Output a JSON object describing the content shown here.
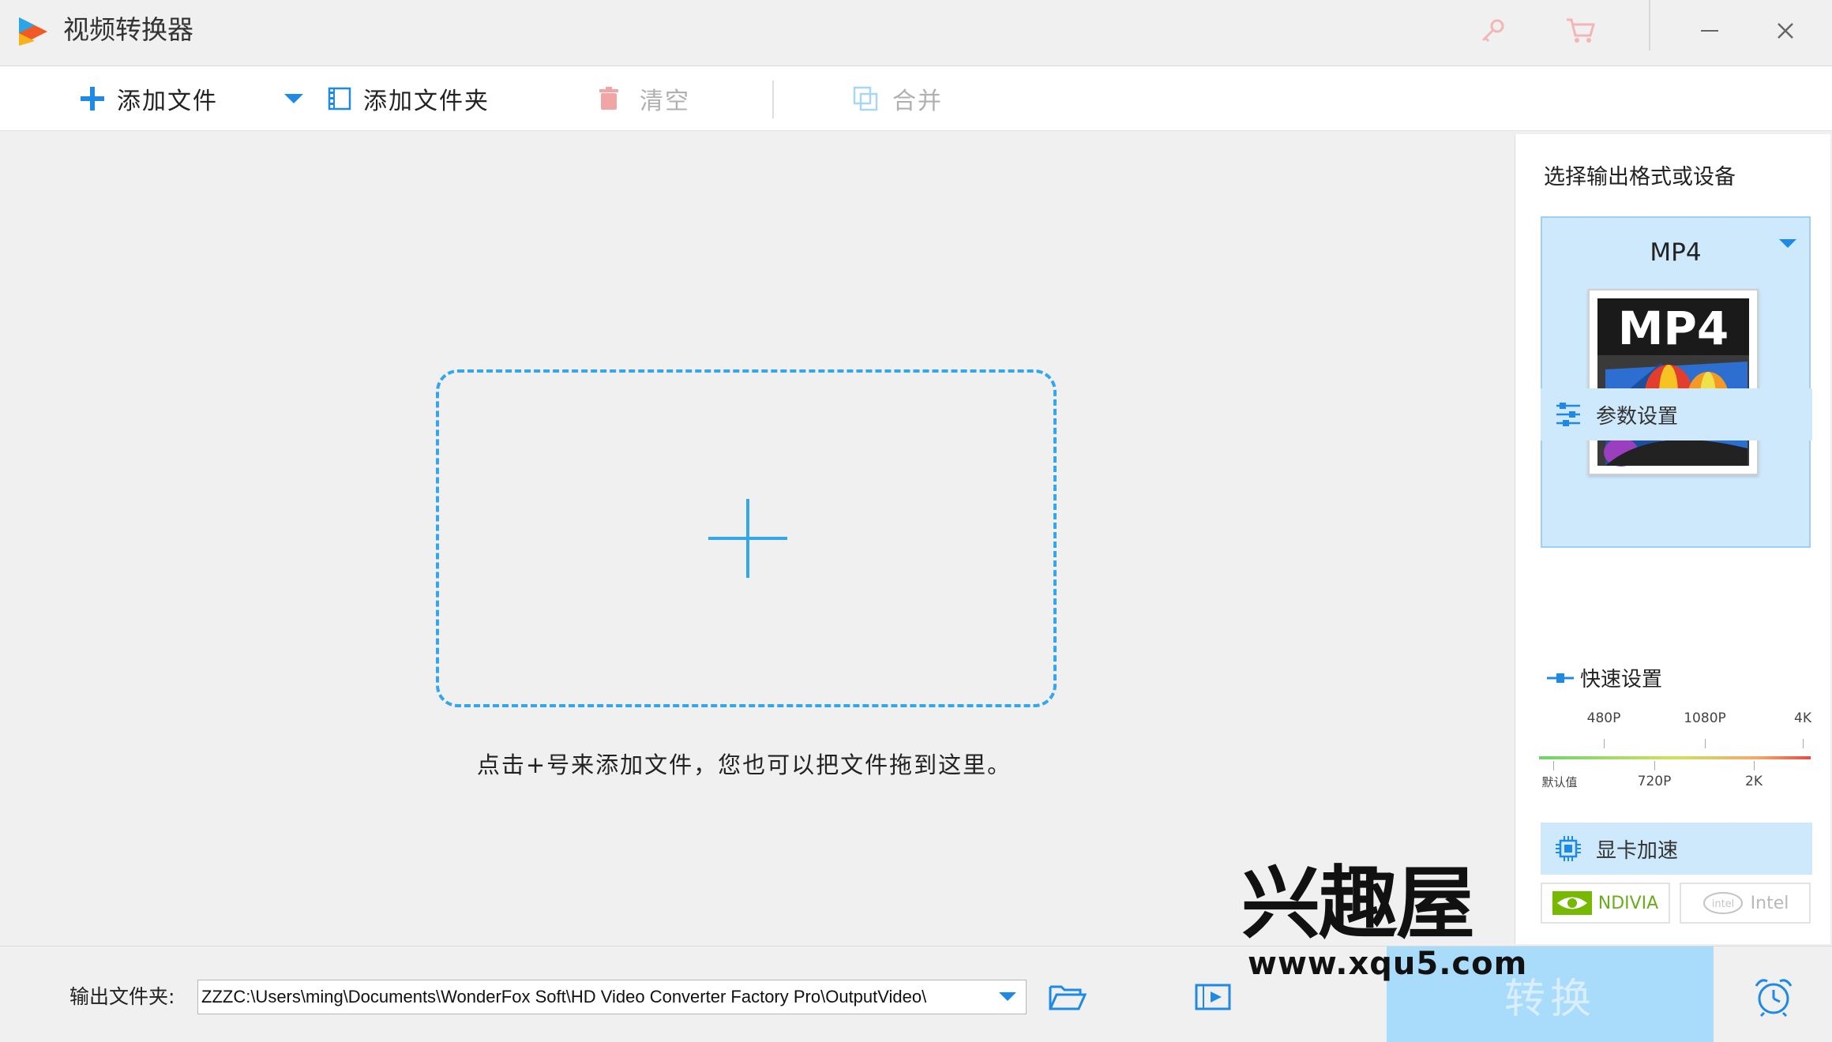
{
  "window": {
    "title": "视频转换器",
    "controls": {
      "minimize": "—",
      "close": "✕"
    }
  },
  "toolbar": {
    "add_file_label": "添加文件",
    "add_folder_label": "添加文件夹",
    "clear_label": "清空",
    "merge_label": "合并"
  },
  "main": {
    "hint": "点击+号来添加文件，您也可以把文件拖到这里。"
  },
  "panel": {
    "title": "选择输出格式或设备",
    "format": {
      "name": "MP4",
      "thumb_text": "MP4"
    },
    "params_label": "参数设置",
    "quick_title": "快速设置",
    "slider": {
      "top_labels": [
        "480P",
        "1080P",
        "4K"
      ],
      "bottom_labels": [
        "默认值",
        "720P",
        "2K"
      ]
    },
    "gpu_label": "显卡加速",
    "nvidia_label": "NDIVIA",
    "intel_label": "Intel",
    "intel_logo": "intel"
  },
  "bottom": {
    "output_label": "输出文件夹:",
    "output_path": "ZZZC:\\Users\\ming\\Documents\\WonderFox Soft\\HD Video Converter Factory Pro\\OutputVideo\\",
    "convert_label": "转换"
  },
  "watermark": {
    "brand": "兴趣屋",
    "url": "www.xqu5.com"
  },
  "colors": {
    "accent": "#34a6ea",
    "panel_blue": "#cde9fb",
    "convert_bg": "#a9dbfa"
  }
}
